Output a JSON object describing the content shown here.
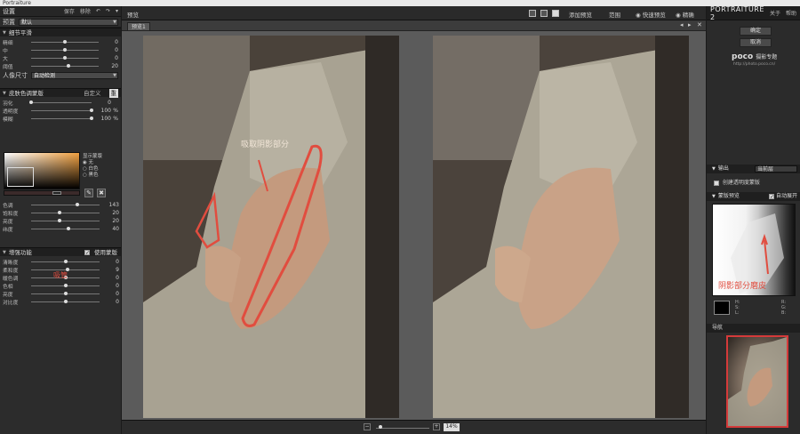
{
  "window": {
    "title": "Portraiture"
  },
  "left_panel": {
    "title": "设置",
    "save_label": "保存",
    "delete_label": "移除",
    "preset_label": "预置",
    "preset_value": "默认",
    "detail_section": "细节平滑",
    "detail_sliders": [
      {
        "label": "精细",
        "value": "0",
        "pos": 0.5
      },
      {
        "label": "中",
        "value": "0",
        "pos": 0.5
      },
      {
        "label": "大",
        "value": "0",
        "pos": 0.5
      },
      {
        "label": "阈值",
        "value": "20",
        "pos": 0.55
      }
    ],
    "portrait_size_label": "人像尺寸",
    "portrait_size_value": "自动检测",
    "skin_section": "皮肤色调蒙版",
    "skin_mode": "自定义",
    "skin_mode_btn": "重",
    "skin_sliders": [
      {
        "label": "羽化",
        "value": "0",
        "unit": "",
        "pos": 0.0
      },
      {
        "label": "透明度",
        "value": "100",
        "unit": "%",
        "pos": 1.0
      },
      {
        "label": "模糊",
        "value": "100",
        "unit": "%",
        "pos": 1.0
      }
    ],
    "show_mask_label": "显示蒙版",
    "show_mask_options": [
      {
        "label": "无",
        "selected": true
      },
      {
        "label": "白色",
        "selected": false
      },
      {
        "label": "黑色",
        "selected": false
      }
    ],
    "color_sliders": [
      {
        "label": "色调",
        "value": "143",
        "pos": 0.68
      },
      {
        "label": "饱和度",
        "value": "20",
        "pos": 0.42
      },
      {
        "label": "亮度",
        "value": "20",
        "pos": 0.42
      },
      {
        "label": "纬度",
        "value": "40",
        "pos": 0.55
      }
    ],
    "enhance_section": "增强功能",
    "use_mask_label": "使用蒙版",
    "enhance_sliders": [
      {
        "label": "清晰度",
        "value": "0",
        "pos": 0.5
      },
      {
        "label": "柔和度",
        "value": "9",
        "pos": 0.53
      },
      {
        "label": "暖色调",
        "value": "0",
        "pos": 0.5
      },
      {
        "label": "色相",
        "value": "0",
        "pos": 0.5
      },
      {
        "label": "亮度",
        "value": "0",
        "pos": 0.5
      },
      {
        "label": "对比度",
        "value": "0",
        "pos": 0.5
      }
    ]
  },
  "center": {
    "preview_label": "预览",
    "add_preview": "添加预览",
    "scope": "范围",
    "quick_preview": "快速预览",
    "precise": "精确",
    "tab_label": "预览1",
    "zoom_value": "14%",
    "annotation_text": "吸取阴影部分",
    "straw_text": "吸管"
  },
  "right_panel": {
    "brand": "PORTRAITURE 2",
    "about": "关于",
    "help": "帮助",
    "ok_label": "确定",
    "cancel_label": "取消",
    "poco_logo": "poco",
    "poco_sub": "摄影专题",
    "poco_url": "http://photo.poco.cn/",
    "output_section": "输出",
    "output_value": "当前层",
    "create_transparent_label": "创建透明度蒙版",
    "mask_preview_section": "蒙版预览",
    "auto_expand_label": "自动展开",
    "mask_annotation": "阴影部分磨皮",
    "hsl_labels": [
      "H:",
      "S:",
      "L:"
    ],
    "rgb_labels": [
      "R:",
      "G:",
      "B:"
    ],
    "nav_section": "导航"
  },
  "colors": {
    "annotation_red": "#e14d3f",
    "nav_border": "#d43a3a"
  }
}
